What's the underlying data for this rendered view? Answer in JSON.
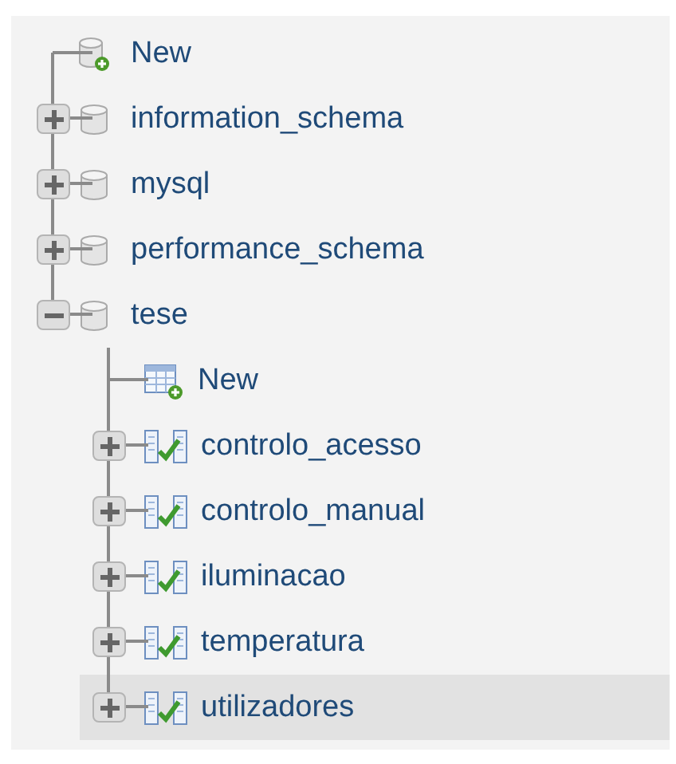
{
  "tree": [
    {
      "kind": "new",
      "label": "New"
    },
    {
      "kind": "database",
      "label": "information_schema",
      "expanded": false
    },
    {
      "kind": "database",
      "label": "mysql",
      "expanded": false
    },
    {
      "kind": "database",
      "label": "performance_schema",
      "expanded": false
    },
    {
      "kind": "database",
      "label": "tese",
      "expanded": true,
      "children": [
        {
          "kind": "new",
          "label": "New"
        },
        {
          "kind": "table",
          "label": "controlo_acesso",
          "expanded": false,
          "selected": false
        },
        {
          "kind": "table",
          "label": "controlo_manual",
          "expanded": false,
          "selected": false
        },
        {
          "kind": "table",
          "label": "iluminacao",
          "expanded": false,
          "selected": false
        },
        {
          "kind": "table",
          "label": "temperatura",
          "expanded": false,
          "selected": false
        },
        {
          "kind": "table",
          "label": "utilizadores",
          "expanded": false,
          "selected": true
        }
      ]
    }
  ]
}
